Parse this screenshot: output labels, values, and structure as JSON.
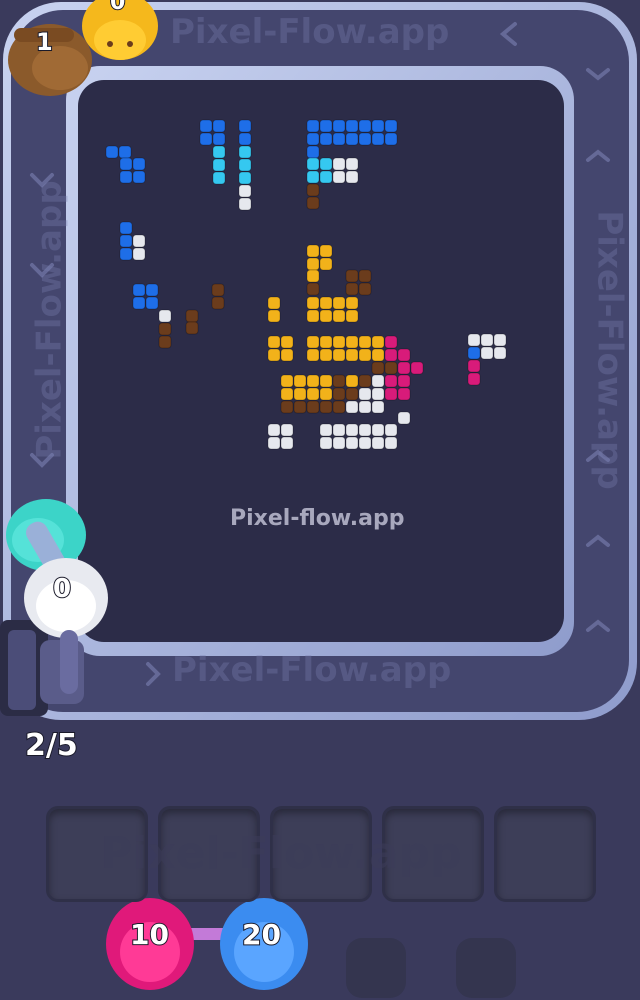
{
  "watermarks": {
    "top": "Pixel-Flow.app",
    "left": "Pixel-Flow.app",
    "right": "Pixel-Flow.app",
    "bottom": "Pixel-Flow.app",
    "center": "Pixel-flow.app",
    "tray": "Pixel-Flow.app"
  },
  "conveyor_shooters": [
    {
      "color_name": "gold",
      "color": "#f5b81c",
      "count": "0"
    },
    {
      "color_name": "brown",
      "color": "#8b5a2b",
      "count": "1"
    },
    {
      "color_name": "teal",
      "color": "#3cd4c8",
      "count": ""
    },
    {
      "color_name": "white",
      "color": "#e8eaf0",
      "count": "0"
    }
  ],
  "queue_counter": "2/5",
  "tray_slots": [
    "",
    "",
    "",
    "",
    ""
  ],
  "waiting_shooters": [
    {
      "color_name": "magenta",
      "color": "#e0197a",
      "count": "10"
    },
    {
      "color_name": "blue",
      "color": "#3b8cf0",
      "count": "20"
    }
  ],
  "block_colors": {
    "blue": "#1e6ee8",
    "cyan": "#35c8f0",
    "white": "#e6e8ee",
    "brown": "#6b3c1c",
    "gold": "#f2b21a",
    "magenta": "#d81b7a"
  }
}
